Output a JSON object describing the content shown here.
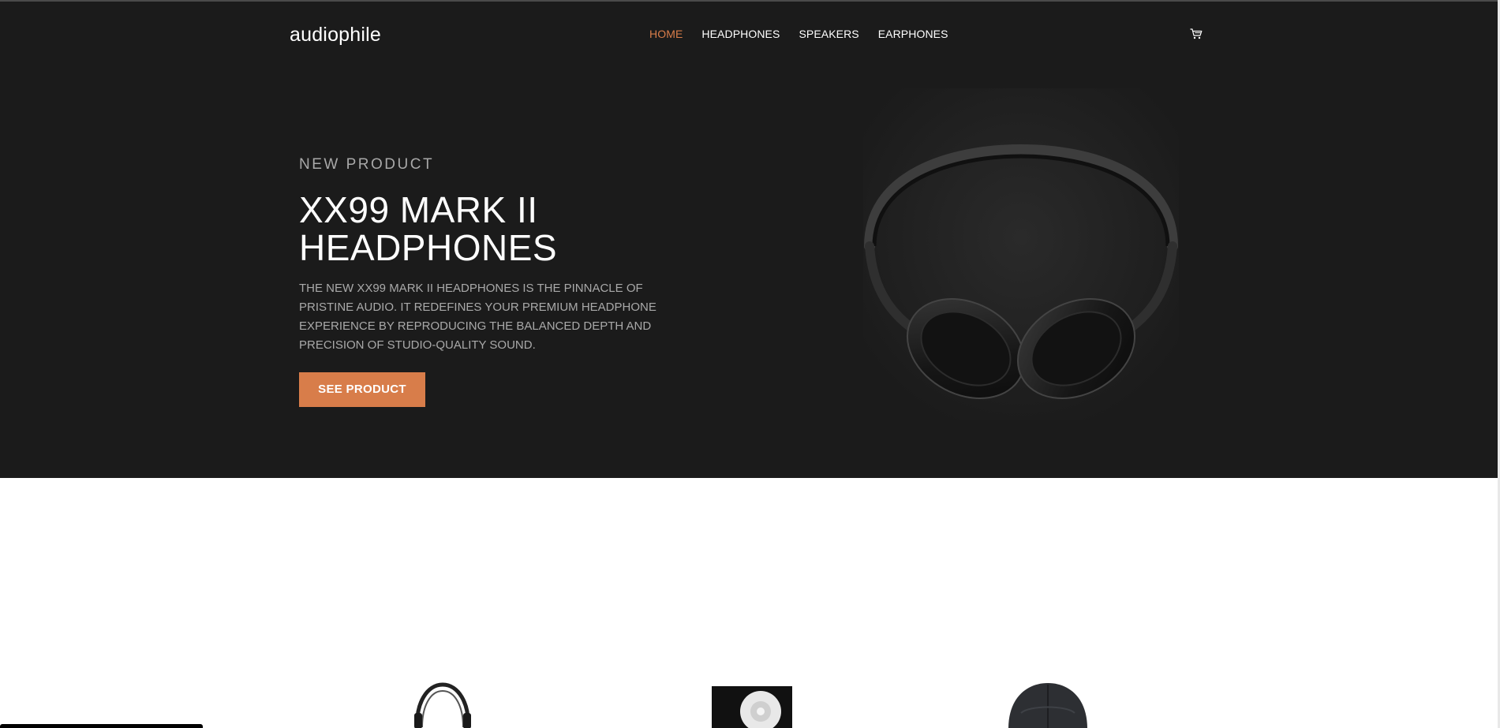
{
  "brand": {
    "logo": "audiophile",
    "accent_color": "#d87d4a",
    "hero_bg": "#1b1b1b"
  },
  "nav": {
    "items": [
      {
        "label": "HOME",
        "active": true
      },
      {
        "label": "HEADPHONES",
        "active": false
      },
      {
        "label": "SPEAKERS",
        "active": false
      },
      {
        "label": "EARPHONES",
        "active": false
      }
    ],
    "cart_icon": "cart-icon"
  },
  "hero": {
    "overline": "NEW PRODUCT",
    "title": "XX99 MARK II HEADPHONES",
    "description": "THE NEW XX99 MARK II HEADPHONES IS THE PINNACLE OF PRISTINE AUDIO. IT REDEFINES YOUR PREMIUM HEADPHONE EXPERIENCE BY REPRODUCING THE BALANCED DEPTH AND PRECISION OF STUDIO-QUALITY SOUND.",
    "cta_label": "SEE PRODUCT",
    "image_icon": "headphones-image"
  },
  "categories": {
    "thumbnails": [
      "headphones-thumbnail",
      "speaker-thumbnail",
      "earphones-thumbnail"
    ]
  }
}
